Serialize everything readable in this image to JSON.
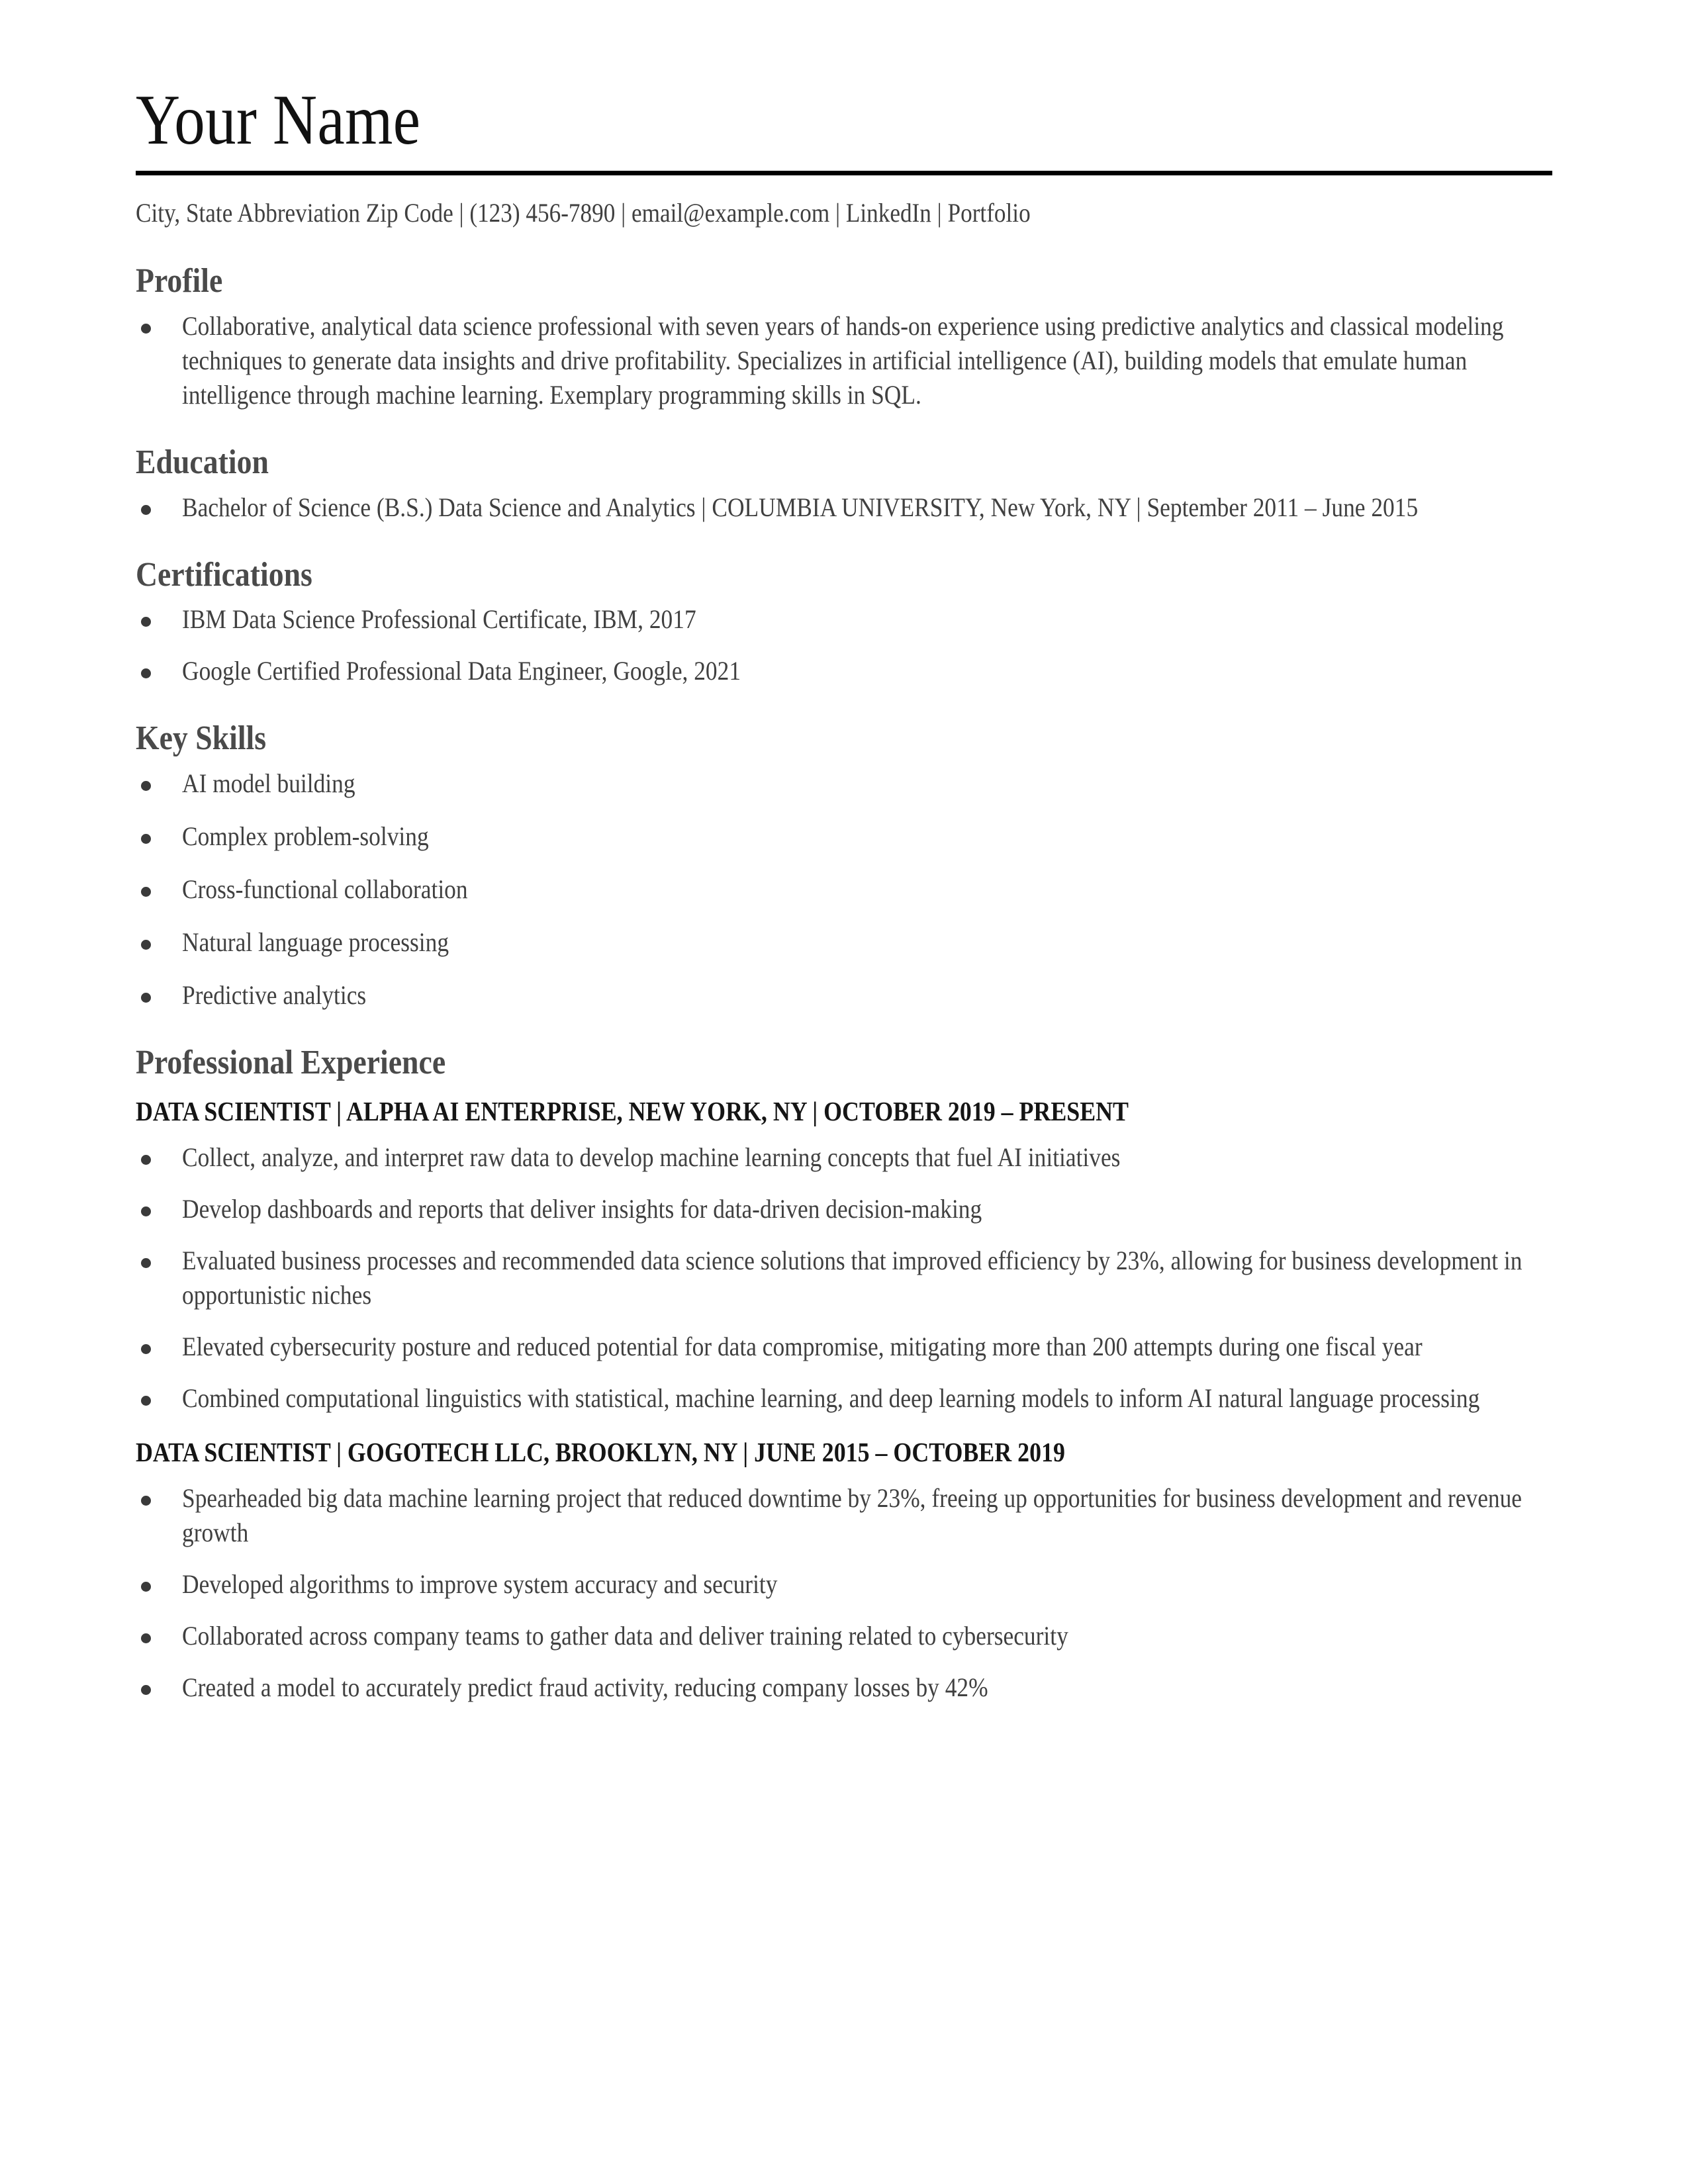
{
  "header": {
    "name": "Your Name",
    "contact": "City, State Abbreviation Zip Code | (123) 456-7890 | email@example.com | LinkedIn | Portfolio"
  },
  "profile": {
    "title": "Profile",
    "items": [
      "Collaborative, analytical data science professional with seven years of hands-on experience using predictive analytics and classical modeling techniques to generate data insights and drive profitability. Specializes in artificial intelligence (AI), building models that emulate human intelligence through machine learning. Exemplary programming skills in SQL."
    ]
  },
  "education": {
    "title": "Education",
    "items": [
      "Bachelor of Science (B.S.) Data Science and Analytics | COLUMBIA UNIVERSITY, New York, NY | September 2011 – June 2015"
    ]
  },
  "certifications": {
    "title": "Certifications",
    "items": [
      "IBM Data Science Professional Certificate, IBM, 2017",
      "Google Certified Professional Data Engineer, Google, 2021"
    ]
  },
  "key_skills": {
    "title": "Key Skills",
    "items": [
      "AI model building",
      "Complex problem-solving",
      "Cross-functional collaboration",
      "Natural language processing",
      "Predictive analytics"
    ]
  },
  "experience": {
    "title": "Professional Experience",
    "jobs": [
      {
        "heading": "DATA SCIENTIST | ALPHA AI ENTERPRISE, NEW YORK, NY | OCTOBER 2019 – PRESENT",
        "bullets": [
          "Collect, analyze, and interpret raw data to develop machine learning concepts that fuel AI initiatives",
          "Develop dashboards and reports that deliver insights for data-driven decision-making",
          "Evaluated business processes and recommended data science solutions that improved efficiency by 23%, allowing for business development in opportunistic niches",
          "Elevated cybersecurity posture and reduced potential for data compromise, mitigating more than 200 attempts during one fiscal year",
          "Combined computational linguistics with statistical, machine learning, and deep learning models to inform AI natural language processing"
        ]
      },
      {
        "heading": "DATA SCIENTIST | GOGOTECH LLC, BROOKLYN, NY | JUNE 2015 – OCTOBER 2019",
        "bullets": [
          "Spearheaded big data machine learning project that reduced downtime by 23%, freeing up opportunities for business development and revenue growth",
          "Developed algorithms to improve system accuracy and security",
          "Collaborated across company teams to gather data and deliver training related to cybersecurity",
          "Created a model to accurately predict fraud activity, reducing company losses by 42%"
        ]
      }
    ]
  },
  "colors": {
    "body_text": "#404040",
    "heading_text": "#4a4a4a",
    "name_text": "#111111",
    "job_title_text": "#151515",
    "rule": "#000000",
    "background": "#ffffff"
  }
}
